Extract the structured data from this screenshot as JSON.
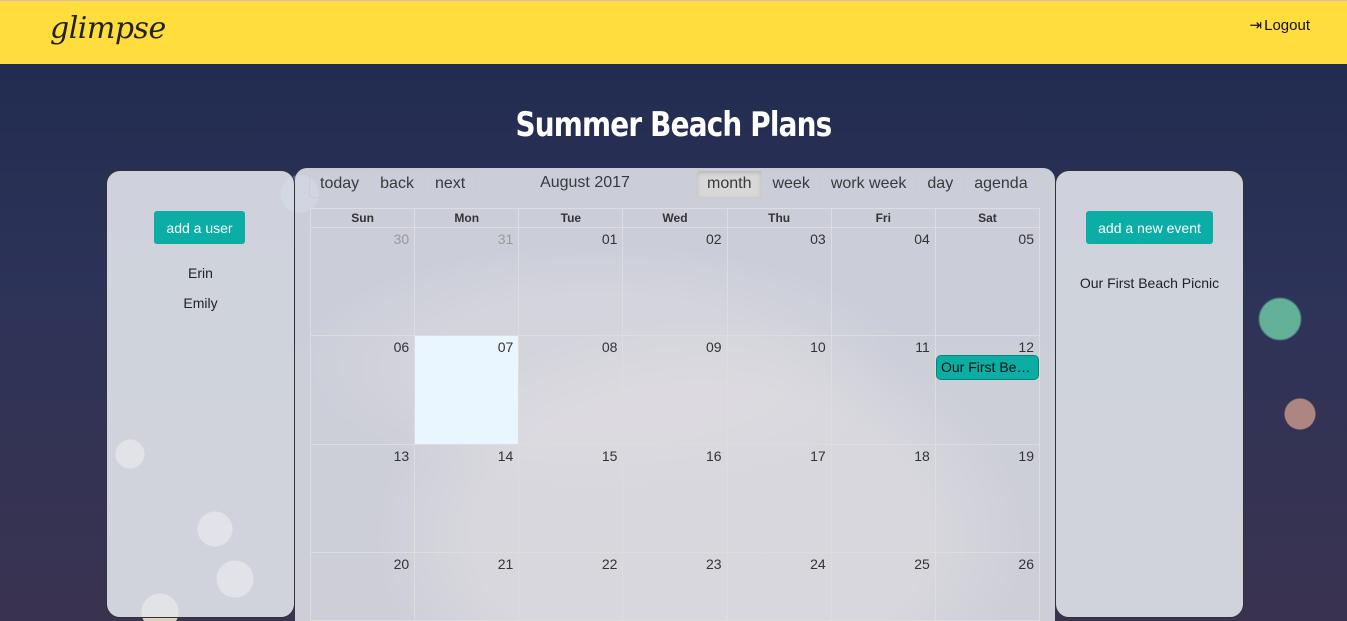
{
  "header": {
    "logo": "glimpse",
    "logout_label": "Logout",
    "logout_icon": "sign-in-icon",
    "bg_color": "#ffdd3d"
  },
  "page": {
    "title": "Summer Beach Plans"
  },
  "users_panel": {
    "add_button": "add a user",
    "users": [
      "Erin",
      "Emily"
    ]
  },
  "events_panel": {
    "add_button": "add a new event",
    "events": [
      "Our First Beach Picnic"
    ]
  },
  "calendar": {
    "nav": [
      "today",
      "back",
      "next"
    ],
    "label": "August 2017",
    "views": [
      "month",
      "week",
      "work week",
      "day",
      "agenda"
    ],
    "active_view": "month",
    "weekdays": [
      "Sun",
      "Mon",
      "Tue",
      "Wed",
      "Thu",
      "Fri",
      "Sat"
    ],
    "weeks": [
      [
        "30",
        "31",
        "01",
        "02",
        "03",
        "04",
        "05"
      ],
      [
        "06",
        "07",
        "08",
        "09",
        "10",
        "11",
        "12"
      ],
      [
        "13",
        "14",
        "15",
        "16",
        "17",
        "18",
        "19"
      ],
      [
        "20",
        "21",
        "22",
        "23",
        "24",
        "25",
        "26"
      ]
    ],
    "off_range": [
      "30",
      "31"
    ],
    "today": "07",
    "event_chip": "Our First Beach Picnic",
    "accent_color": "#0bada4"
  }
}
